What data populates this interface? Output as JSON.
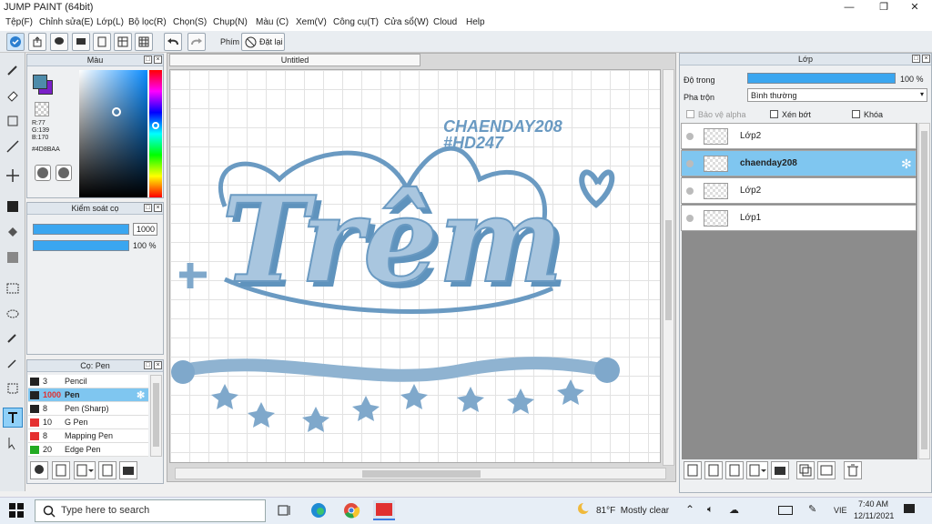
{
  "app": {
    "title": "JUMP PAINT (64bit)"
  },
  "window_controls": {
    "minimize": "—",
    "restore": "❐",
    "close": "✕"
  },
  "menu": [
    "Tệp(F)",
    "Chỉnh sửa(E)",
    "Lớp(L)",
    "Bộ lọc(R)",
    "Chọn(S)",
    "Chụp(N)",
    "Màu (C)",
    "Xem(V)",
    "Công cụ(T)",
    "Cửa sổ(W)",
    "Cloud",
    "Help"
  ],
  "toolbar": {
    "key_label": "Phím",
    "reset_label": "Đặt lại"
  },
  "color_panel": {
    "title": "Màu",
    "r": "R:77",
    "g": "G:139",
    "b": "B:170",
    "hex": "#4D8BAA",
    "color": "#4D8BAA"
  },
  "brush_control": {
    "title": "Kiểm soát cọ",
    "size": "1000",
    "opacity": "100 %",
    "size_fill": 1.0,
    "opacity_fill": 1.0
  },
  "brush_panel": {
    "title": "Cọ: Pen",
    "items": [
      {
        "size": "3",
        "name": "Pencil",
        "color": "#222222"
      },
      {
        "size": "1000",
        "name": "Pen",
        "color": "#222222"
      },
      {
        "size": "8",
        "name": "Pen (Sharp)",
        "color": "#222222"
      },
      {
        "size": "10",
        "name": "G Pen",
        "color": "#e53030"
      },
      {
        "size": "8",
        "name": "Mapping Pen",
        "color": "#e53030"
      },
      {
        "size": "20",
        "name": "Edge Pen",
        "color": "#22aa22"
      }
    ]
  },
  "document": {
    "tab": "Untitled"
  },
  "artwork": {
    "watermark_line1": "CHAENDAY208",
    "watermark_line2": "#HD247",
    "main_text": "Trêm",
    "color": "#8fb3d1",
    "shade": "#5f93bd"
  },
  "layer_panel": {
    "title": "Lớp",
    "opacity_label": "Độ trong",
    "opacity_value": "100 %",
    "opacity_fill": 1.0,
    "blend_label": "Pha trộn",
    "blend_value": "Bình thường",
    "protect_alpha": "Bảo vệ alpha",
    "clip": "Xén bớt",
    "lock": "Khóa",
    "layers": [
      {
        "name": "Lớp2"
      },
      {
        "name": "chaenday208"
      },
      {
        "name": "Lớp2"
      },
      {
        "name": "Lớp1"
      }
    ]
  },
  "taskbar": {
    "search_placeholder": "Type here to search",
    "weather": "81°F  Mostly clear",
    "lang": "VIE",
    "time": "7:40 AM",
    "date": "12/11/2021"
  }
}
